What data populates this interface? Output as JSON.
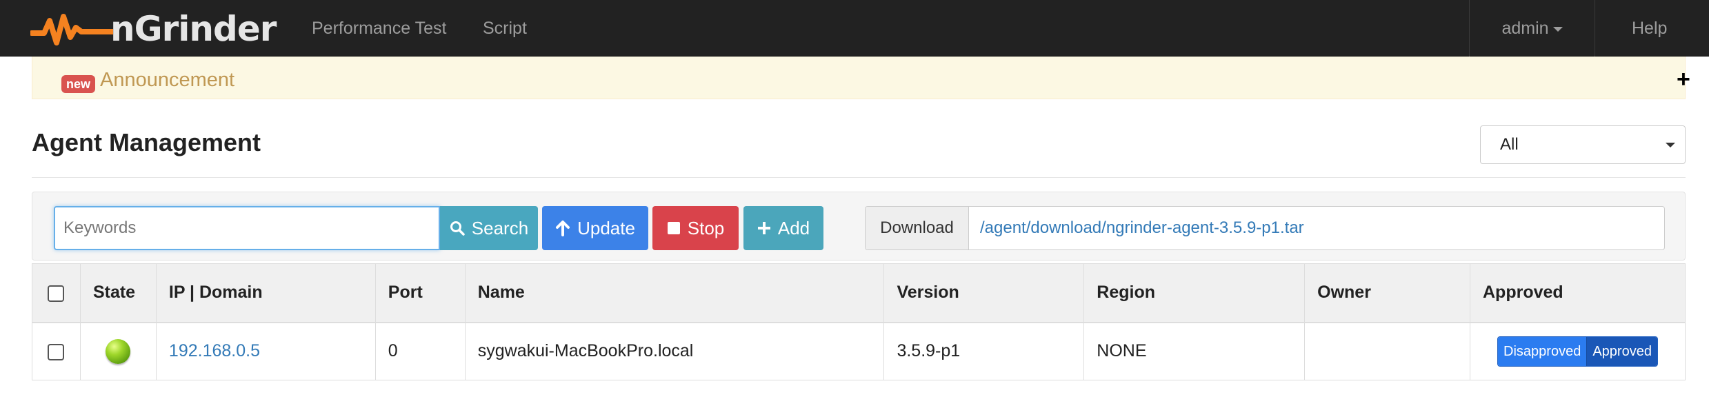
{
  "navbar": {
    "brand": "nGrinder",
    "links": [
      "Performance Test",
      "Script"
    ],
    "user_menu": "admin",
    "help": "Help"
  },
  "announcement": {
    "badge": "new",
    "title": "Announcement",
    "toggle": "+"
  },
  "header": {
    "title": "Agent Management",
    "region_select": "All"
  },
  "toolbar": {
    "keywords_placeholder": "Keywords",
    "search_label": "Search",
    "update_label": "Update",
    "stop_label": "Stop",
    "add_label": "Add",
    "download_label": "Download",
    "download_link": "/agent/download/ngrinder-agent-3.5.9-p1.tar"
  },
  "table": {
    "columns": [
      "State",
      "IP | Domain",
      "Port",
      "Name",
      "Version",
      "Region",
      "Owner",
      "Approved"
    ],
    "rows": [
      {
        "state": "running",
        "ip": "192.168.0.5",
        "port": "0",
        "name": "sygwakui-MacBookPro.local",
        "version": "3.5.9-p1",
        "region": "NONE",
        "owner": "",
        "disapproved_label": "Disapproved",
        "approved_label": "Approved"
      }
    ]
  },
  "colors": {
    "navbar_bg": "#222222",
    "brand_orange": "#f58220",
    "search_btn": "#49a7bf",
    "update_btn": "#3c82e8",
    "stop_btn": "#d9434b",
    "add_btn": "#4ba6bb",
    "state_running": "#8ac926"
  },
  "icons": {
    "search": "search-icon",
    "update": "arrow-up-icon",
    "stop": "stop-square-icon",
    "add": "plus-icon"
  }
}
